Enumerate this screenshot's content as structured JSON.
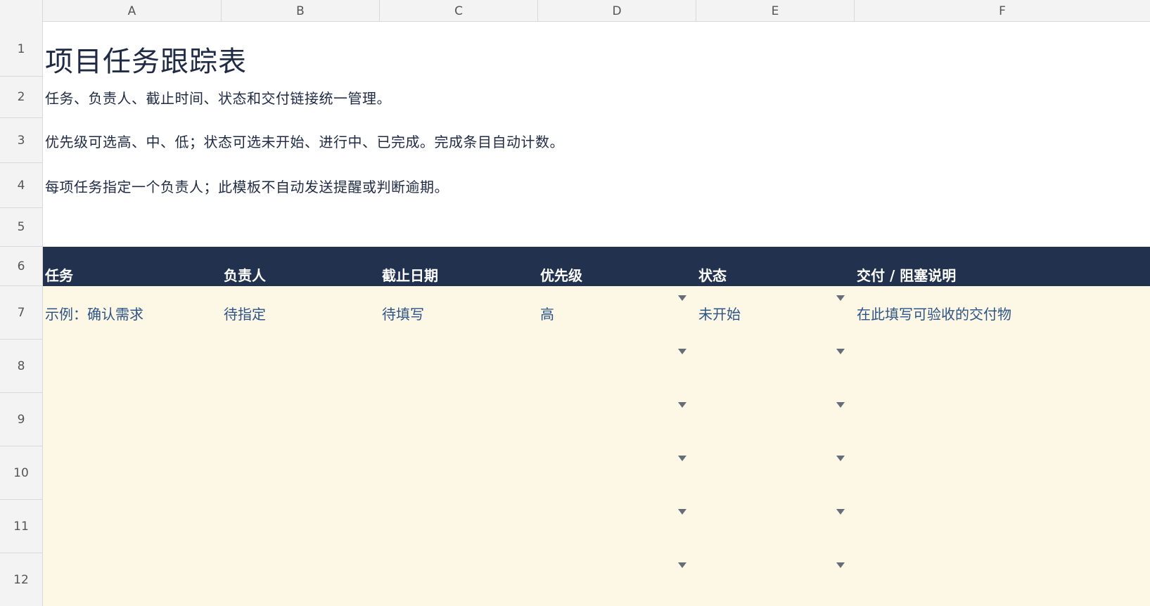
{
  "columns": [
    "A",
    "B",
    "C",
    "D",
    "E",
    "F"
  ],
  "rows": [
    "1",
    "2",
    "3",
    "4",
    "5",
    "6",
    "7",
    "8",
    "9",
    "10",
    "11",
    "12"
  ],
  "title": "项目任务跟踪表",
  "notes": [
    "任务、负责人、截止时间、状态和交付链接统一管理。",
    "优先级可选高、中、低；状态可选未开始、进行中、已完成。完成条目自动计数。",
    "每项任务指定一个负责人；此模板不自动发送提醒或判断逾期。"
  ],
  "table_headers": [
    "任务",
    "负责人",
    "截止日期",
    "优先级",
    "状态",
    "交付 / 阻塞说明"
  ],
  "example_row": [
    "示例：确认需求",
    "待指定",
    "待填写",
    "高",
    "未开始",
    "在此填写可验收的交付物"
  ],
  "colors": {
    "header_bg": "#22314d",
    "data_bg": "#fdf7e6",
    "title_text": "#1f2a44",
    "data_text": "#2d5487",
    "dropdown_arrow": "#666d78"
  },
  "icons": [
    "dropdown-arrow-icon"
  ]
}
